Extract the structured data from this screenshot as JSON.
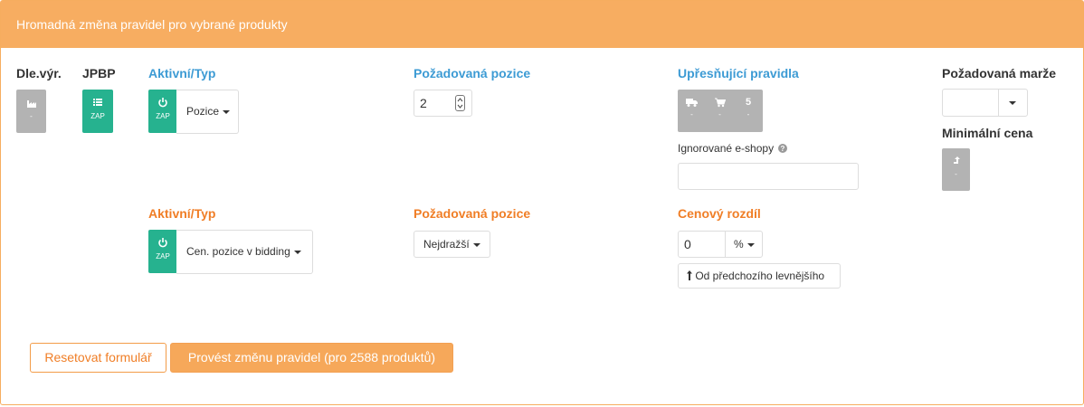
{
  "header": {
    "title": "Hromadná změna pravidel pro vybrané produkty"
  },
  "row1": {
    "dle_vyr": {
      "label": "Dle.výr.",
      "icon": "factory-icon",
      "value": "-"
    },
    "jpbp": {
      "label": "JPBP",
      "icon": "list-icon",
      "state": "ZAP"
    },
    "aktivni": {
      "label": "Aktivní/Typ",
      "state": "ZAP",
      "icon": "power-icon",
      "type": "Pozice"
    },
    "pozice": {
      "label": "Požadovaná pozice",
      "value": "2"
    },
    "upresnujici": {
      "label": "Upřesňující pravidla",
      "truck": {
        "icon": "truck-icon",
        "value": "-"
      },
      "cart": {
        "icon": "cart-icon",
        "value": "-"
      },
      "five": {
        "label": "5",
        "value": "-"
      }
    },
    "ignorovane": {
      "label": "Ignorované e-shopy",
      "icon": "question-circle-icon",
      "value": ""
    },
    "marze": {
      "label": "Požadovaná marže",
      "value": ""
    },
    "min_cena": {
      "label": "Minimální cena",
      "icon": "arrow-up-corner-icon",
      "value": "-"
    }
  },
  "row2": {
    "aktivni": {
      "label": "Aktivní/Typ",
      "state": "ZAP",
      "icon": "power-icon",
      "type": "Cen. pozice v bidding"
    },
    "pozice": {
      "label": "Požadovaná pozice",
      "value": "Nejdražší"
    },
    "rozdil": {
      "label": "Cenový rozdíl",
      "value": "0",
      "unit": "%",
      "from_label": "Od předchozího levnějšího",
      "from_icon": "arrow-up-icon"
    }
  },
  "buttons": {
    "reset": "Resetovat formulář",
    "apply": "Provést změnu pravidel (pro 2588 produktů)"
  },
  "colors": {
    "header": "#f7ad61",
    "green": "#26b28f",
    "blue": "#3d9bd4",
    "orange": "#f07e26",
    "gray": "#b3b3b3"
  }
}
